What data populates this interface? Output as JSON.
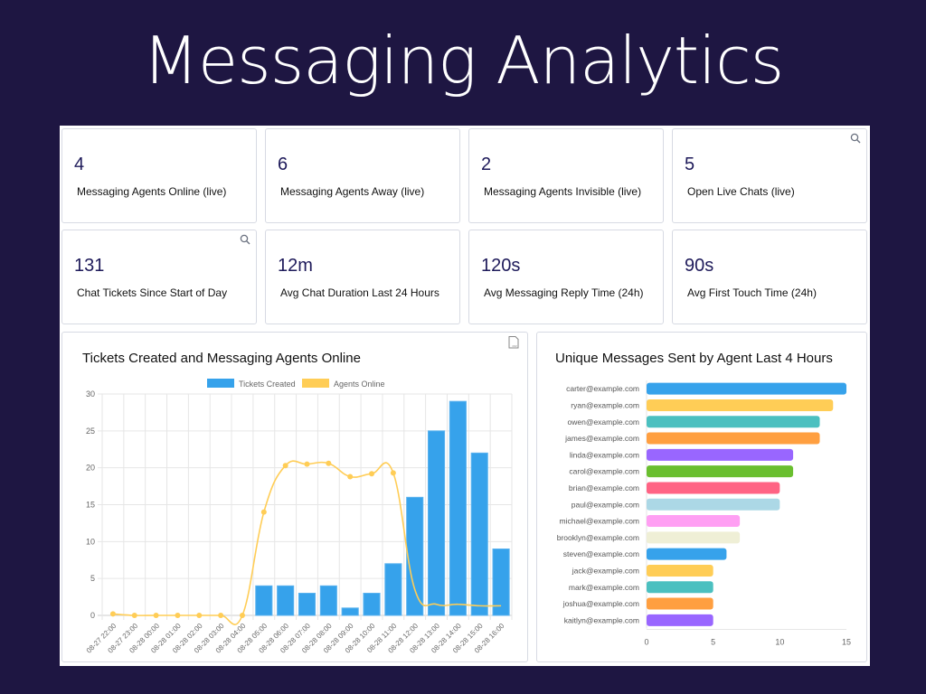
{
  "title": "Messaging Analytics",
  "stats": [
    {
      "value": "4",
      "label": "Messaging Agents Online (live)",
      "search": false
    },
    {
      "value": "6",
      "label": "Messaging Agents Away (live)",
      "search": false
    },
    {
      "value": "2",
      "label": "Messaging Agents Invisible (live)",
      "search": false
    },
    {
      "value": "5",
      "label": "Open Live Chats (live)",
      "search": true
    },
    {
      "value": "131",
      "label": "Chat Tickets Since Start of Day",
      "search": true
    },
    {
      "value": "12m",
      "label": "Avg Chat Duration Last 24 Hours",
      "search": false
    },
    {
      "value": "120s",
      "label": "Avg Messaging Reply Time (24h)",
      "search": false
    },
    {
      "value": "90s",
      "label": "Avg First Touch Time (24h)",
      "search": false
    }
  ],
  "colors": {
    "background": "#1e1642",
    "stat_value": "#1e1a5a",
    "tickets": "#36a2eb",
    "agents": "#ffcd56"
  },
  "chart_data": [
    {
      "type": "bar",
      "title": "Tickets Created and Messaging Agents Online",
      "csv_label": "CSV",
      "legend": [
        "Tickets Created",
        "Agents Online"
      ],
      "legend_position": "top",
      "categories": [
        "08-27 22:00",
        "08-27 23:00",
        "08-28 00:00",
        "08-28 01:00",
        "08-28 02:00",
        "08-28 03:00",
        "08-28 04:00",
        "08-28 05:00",
        "08-28 06:00",
        "08-28 07:00",
        "08-28 08:00",
        "08-28 09:00",
        "08-28 10:00",
        "08-28 11:00",
        "08-28 12:00",
        "08-28 13:00",
        "08-28 14:00",
        "08-28 15:00",
        "08-28 16:00"
      ],
      "series": [
        {
          "name": "Tickets Created",
          "type": "bar",
          "color": "#36a2eb",
          "values": [
            0,
            0,
            0,
            0,
            0,
            0,
            0,
            4,
            4,
            3,
            4,
            1,
            3,
            7,
            16,
            25,
            29,
            22,
            9
          ]
        },
        {
          "name": "Agents Online",
          "type": "line",
          "color": "#ffcd56",
          "values": [
            0.2,
            0,
            0,
            0,
            0,
            0,
            0,
            14,
            20.3,
            20.5,
            20.6,
            18.8,
            19.2,
            19.3,
            3.5,
            1.5,
            1.5,
            1.3,
            1.3
          ]
        }
      ],
      "yticks": [
        0,
        5,
        10,
        15,
        20,
        25,
        30
      ],
      "ylim": [
        0,
        30
      ],
      "grid": true
    },
    {
      "type": "bar",
      "orientation": "horizontal",
      "title": "Unique Messages Sent by Agent Last 4 Hours",
      "categories": [
        "carter@example.com",
        "ryan@example.com",
        "owen@example.com",
        "james@example.com",
        "linda@example.com",
        "carol@example.com",
        "brian@example.com",
        "paul@example.com",
        "michael@example.com",
        "brooklyn@example.com",
        "steven@example.com",
        "jack@example.com",
        "mark@example.com",
        "joshua@example.com",
        "kaitlyn@example.com"
      ],
      "values": [
        15,
        14,
        13,
        13,
        11,
        11,
        10,
        10,
        7,
        7,
        6,
        5,
        5,
        5,
        5
      ],
      "colors": [
        "#36a2eb",
        "#ffcd56",
        "#4bc0c0",
        "#ff9f40",
        "#9966ff",
        "#6abf2f",
        "#ff6384",
        "#acd8e6",
        "#ff9ff3",
        "#efefd6",
        "#36a2eb",
        "#ffcd56",
        "#4bc0c0",
        "#ff9f40",
        "#9966ff"
      ],
      "xticks": [
        0,
        5,
        10,
        15
      ],
      "xlim": [
        0,
        15
      ]
    }
  ]
}
